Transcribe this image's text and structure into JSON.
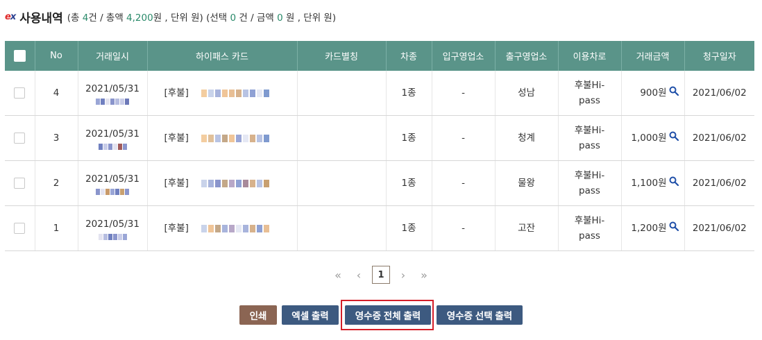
{
  "header": {
    "title": "사용내역",
    "summary_open": "(총 ",
    "total_count": "4",
    "summary_mid1": "건 / 총액 ",
    "total_amount": "4,200",
    "summary_mid2": "원 , 단위 원) (선택 ",
    "selected_count": "0",
    "summary_mid3": " 건 / 금액 ",
    "selected_amount": "0",
    "summary_end": " 원 , 단위 원)"
  },
  "table": {
    "columns": [
      "No",
      "거래일시",
      "하이패스 카드",
      "카드별칭",
      "차종",
      "입구영업소",
      "출구영업소",
      "이용차로",
      "거래금액",
      "청구일자"
    ],
    "rows": [
      {
        "no": "4",
        "date": "2021/05/31",
        "card_prefix": "[후불]",
        "alias": "",
        "car_type": "1종",
        "entrance": "-",
        "exit": "성남",
        "lane": "후불Hi-pass",
        "amount": "900원",
        "bill_date": "2021/06/02"
      },
      {
        "no": "3",
        "date": "2021/05/31",
        "card_prefix": "[후불]",
        "alias": "",
        "car_type": "1종",
        "entrance": "-",
        "exit": "청계",
        "lane": "후불Hi-pass",
        "amount": "1,000원",
        "bill_date": "2021/06/02"
      },
      {
        "no": "2",
        "date": "2021/05/31",
        "card_prefix": "[후불]",
        "alias": "",
        "car_type": "1종",
        "entrance": "-",
        "exit": "물왕",
        "lane": "후불Hi-pass",
        "amount": "1,100원",
        "bill_date": "2021/06/02"
      },
      {
        "no": "1",
        "date": "2021/05/31",
        "card_prefix": "[후불]",
        "alias": "",
        "car_type": "1종",
        "entrance": "-",
        "exit": "고잔",
        "lane": "후불Hi-pass",
        "amount": "1,200원",
        "bill_date": "2021/06/02"
      }
    ]
  },
  "pagination": {
    "current": "1"
  },
  "buttons": {
    "print": "인쇄",
    "excel": "엑셀 출력",
    "receipt_all": "영수증 전체 출력",
    "receipt_selected": "영수증 선택 출력"
  },
  "colors": {
    "header_bg": "#5a9489",
    "primary_button": "#3d5a80",
    "print_button": "#8b6553",
    "highlight": "#d41e28"
  }
}
